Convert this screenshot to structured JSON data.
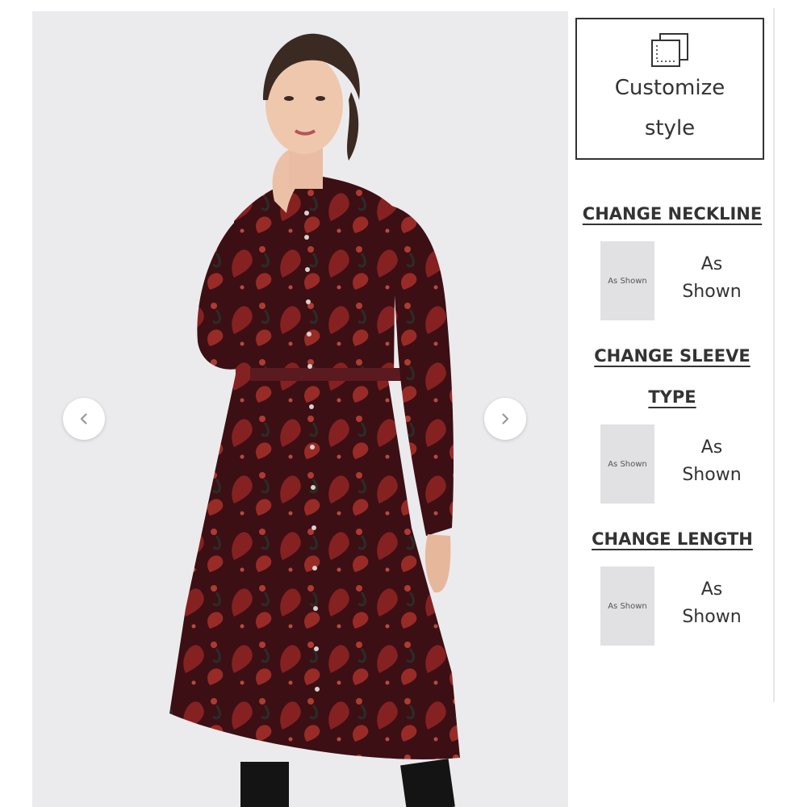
{
  "product": {
    "image_alt": "Model wearing a long-sleeve paisley print button-front dress",
    "prev_icon": "chevron-left-icon",
    "next_icon": "chevron-right-icon"
  },
  "customize": {
    "icon": "layers-icon",
    "line1": "Customize",
    "line2": "style"
  },
  "sections": [
    {
      "title": "CHANGE NECKLINE",
      "swatch_text": "As Shown",
      "label_line1": "As",
      "label_line2": "Shown"
    },
    {
      "title_line1": "CHANGE SLEEVE",
      "title_line2": "TYPE",
      "swatch_text": "As Shown",
      "label_line1": "As",
      "label_line2": "Shown"
    },
    {
      "title": "CHANGE LENGTH",
      "swatch_text": "As Shown",
      "label_line1": "As",
      "label_line2": "Shown"
    }
  ],
  "colors": {
    "dress": "#4a1419",
    "dress_accent": "#a32a2a",
    "background": "#ebebed",
    "swatch": "#e1e1e4"
  }
}
